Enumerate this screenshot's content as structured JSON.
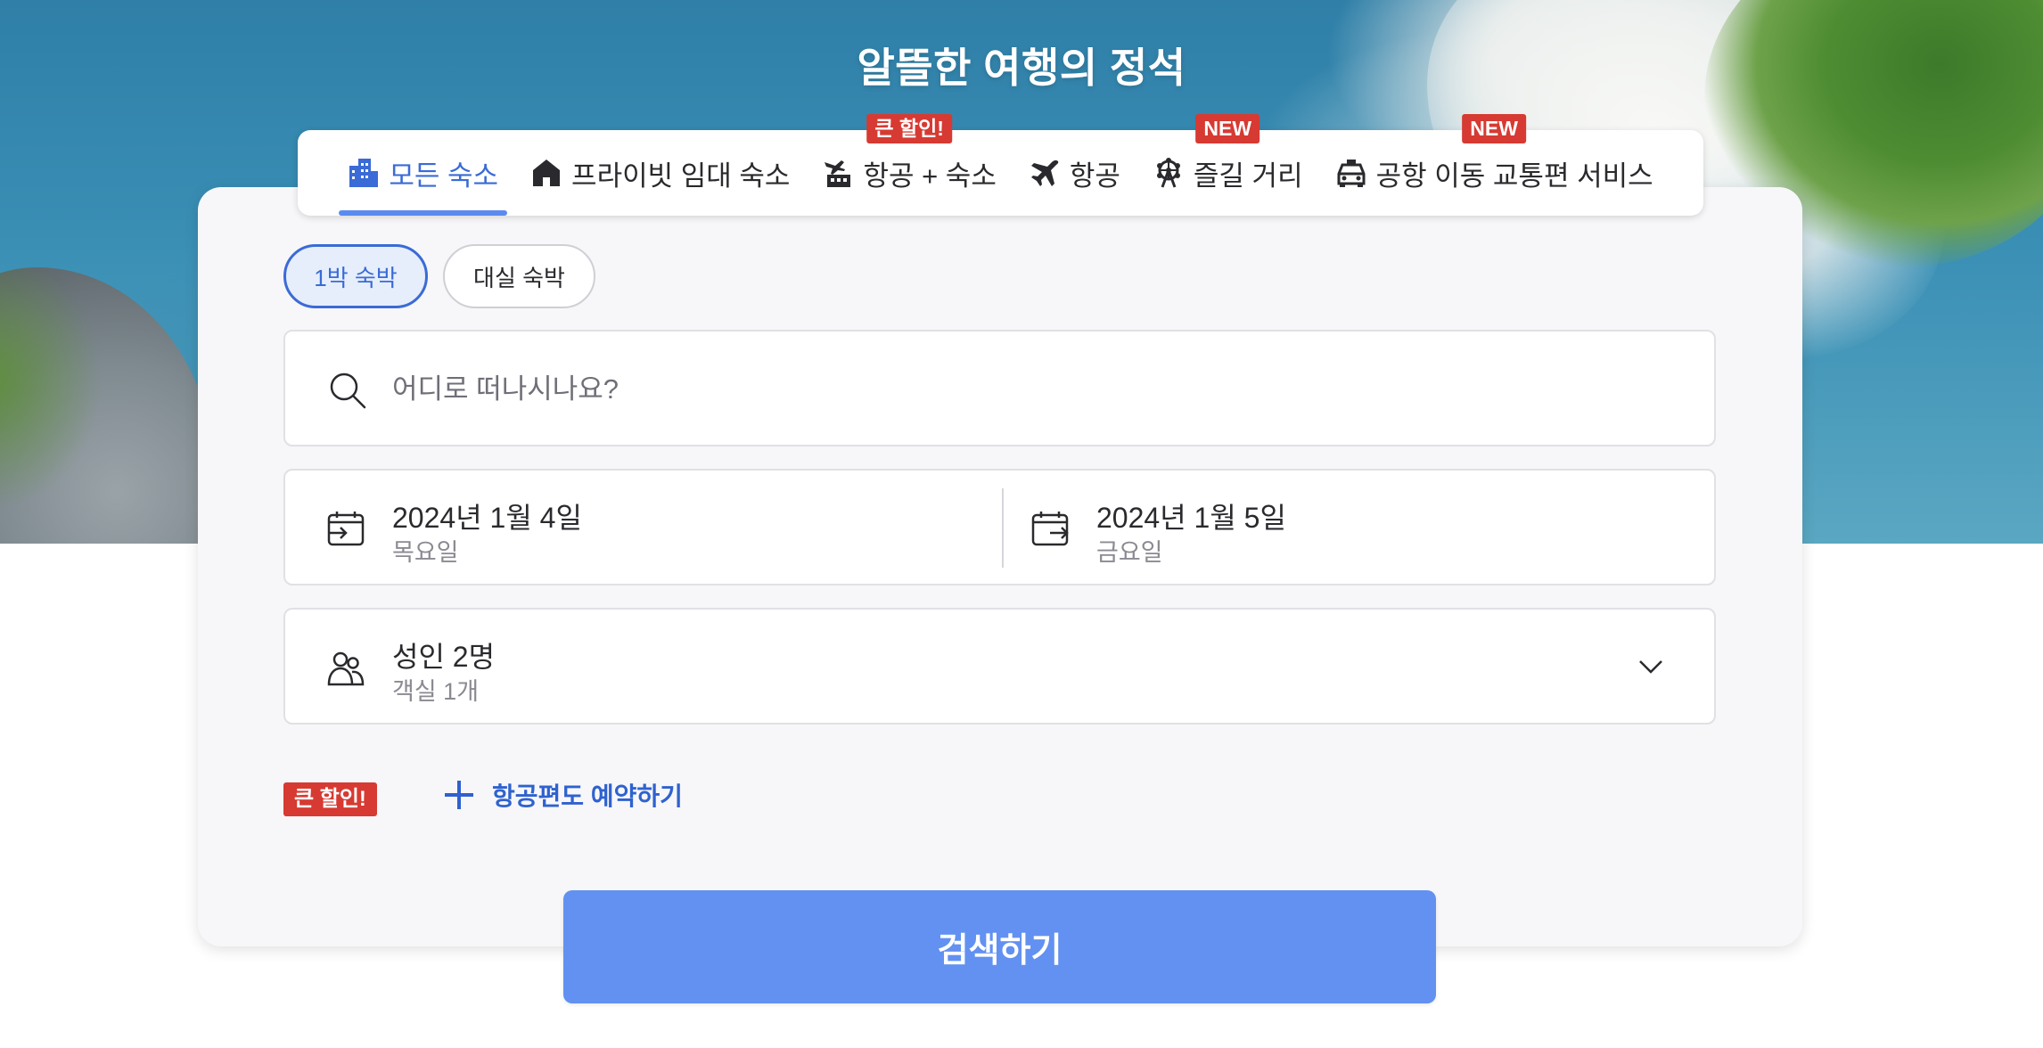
{
  "hero": {
    "title": "알뜰한 여행의 정석"
  },
  "tabs": [
    {
      "label": "모든 숙소",
      "icon": "building-icon",
      "active": true,
      "badge": ""
    },
    {
      "label": "프라이빗 임대 숙소",
      "icon": "house-icon",
      "active": false,
      "badge": ""
    },
    {
      "label": "항공 + 숙소",
      "icon": "flight-hotel-icon",
      "active": false,
      "badge": "큰 할인!"
    },
    {
      "label": "항공",
      "icon": "airplane-icon",
      "active": false,
      "badge": ""
    },
    {
      "label": "즐길 거리",
      "icon": "ferris-wheel-icon",
      "active": false,
      "badge": "NEW"
    },
    {
      "label": "공항 이동 교통편 서비스",
      "icon": "car-icon",
      "active": false,
      "badge": "NEW"
    }
  ],
  "stay_type": {
    "overnight": "1박 숙박",
    "day_use": "대실 숙박",
    "selected": "1박 숙박"
  },
  "search": {
    "placeholder": "어디로 떠나시나요?",
    "value": ""
  },
  "dates": {
    "checkin": {
      "date": "2024년 1월 4일",
      "weekday": "목요일"
    },
    "checkout": {
      "date": "2024년 1월 5일",
      "weekday": "금요일"
    }
  },
  "guests": {
    "adults": "성인 2명",
    "rooms": "객실 1개"
  },
  "promo": {
    "badge": "큰 할인!",
    "add_flight": "항공편도 예약하기"
  },
  "submit": {
    "label": "검색하기"
  },
  "colors": {
    "accent": "#3a6bd6",
    "button": "#6291f1",
    "badge": "#d63a32"
  }
}
